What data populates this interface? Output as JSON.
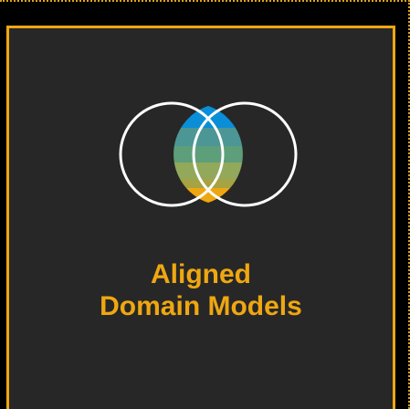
{
  "card": {
    "title_line1": "Aligned",
    "title_line2": "Domain Models"
  },
  "logo": {
    "icon": "overlapping-circles-icon",
    "stripe_colors": [
      "#0a8ed8",
      "#4c9696",
      "#5d9f7a",
      "#92a85b",
      "#a5a343",
      "#efa711"
    ],
    "ring_color": "#ffffff"
  },
  "colors": {
    "accent": "#efa711",
    "card_background": "#272727",
    "page_background": "#000000"
  }
}
